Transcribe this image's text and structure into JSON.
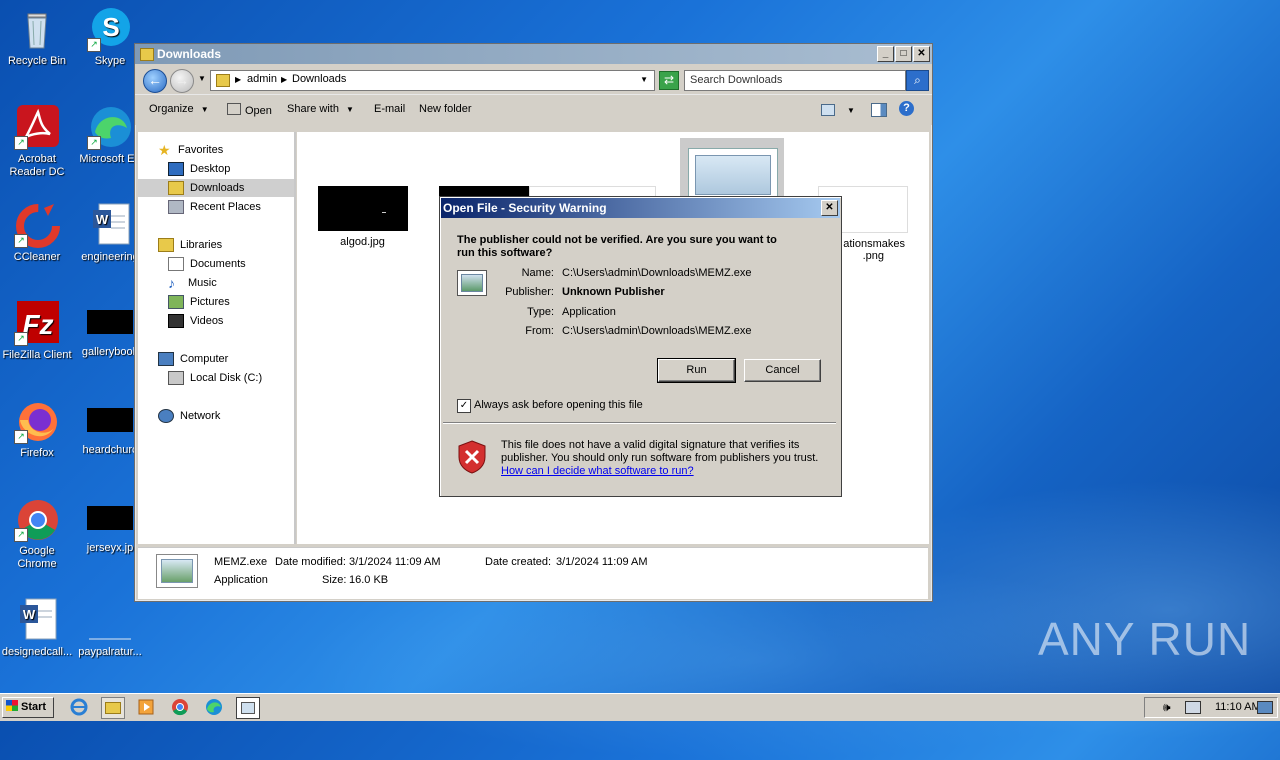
{
  "desktop": {
    "icons": [
      {
        "label": "Recycle Bin"
      },
      {
        "label": "Skype"
      },
      {
        "label": "Acrobat Reader DC"
      },
      {
        "label": "Microsoft Ed"
      },
      {
        "label": "CCleaner"
      },
      {
        "label": "engineering"
      },
      {
        "label": "FileZilla Client"
      },
      {
        "label": "gallerybook"
      },
      {
        "label": "Firefox"
      },
      {
        "label": "heardchurc"
      },
      {
        "label": "Google Chrome"
      },
      {
        "label": "jerseyx.jp"
      },
      {
        "label": "designedcall..."
      },
      {
        "label": "paypalratur..."
      }
    ],
    "watermark": "ANY RUN"
  },
  "explorer": {
    "title": "Downloads",
    "breadcrumb": [
      "admin",
      "Downloads"
    ],
    "search_placeholder": "Search Downloads",
    "toolbar": {
      "organize": "Organize",
      "open": "Open",
      "share_with": "Share with",
      "email": "E-mail",
      "new_folder": "New folder"
    },
    "nav": {
      "favorites": "Favorites",
      "desktop": "Desktop",
      "downloads": "Downloads",
      "recent": "Recent Places",
      "libraries": "Libraries",
      "documents": "Documents",
      "music": "Music",
      "pictures": "Pictures",
      "videos": "Videos",
      "computer": "Computer",
      "local_disk": "Local Disk (C:)",
      "network": "Network"
    },
    "files": [
      {
        "name": "algod.jpg"
      },
      {
        "name": "ationsmakes"
      },
      {
        "name": ".png"
      }
    ],
    "details": {
      "filename": "MEMZ.exe",
      "type": "Application",
      "date_modified_label": "Date modified:",
      "date_modified": "3/1/2024 11:09 AM",
      "size_label": "Size:",
      "size": "16.0 KB",
      "date_created_label": "Date created:",
      "date_created": "3/1/2024 11:09 AM"
    }
  },
  "dialog": {
    "title": "Open File - Security Warning",
    "question_line1": "The publisher could not be verified.  Are you sure you want to",
    "question_line2": "run this software?",
    "name_label": "Name:",
    "name": "C:\\Users\\admin\\Downloads\\MEMZ.exe",
    "publisher_label": "Publisher:",
    "publisher": "Unknown Publisher",
    "type_label": "Type:",
    "type": "Application",
    "from_label": "From:",
    "from": "C:\\Users\\admin\\Downloads\\MEMZ.exe",
    "run_label": "Run",
    "cancel_label": "Cancel",
    "checkbox_label": "Always ask before opening this file",
    "checkbox_checked": true,
    "warning_line1": "This file does not have a valid digital signature that verifies its",
    "warning_line2": "publisher.  You should only run software from publishers you trust.",
    "link": "How can I decide what software to run?"
  },
  "taskbar": {
    "start_label": "Start",
    "clock": "11:10 AM"
  }
}
